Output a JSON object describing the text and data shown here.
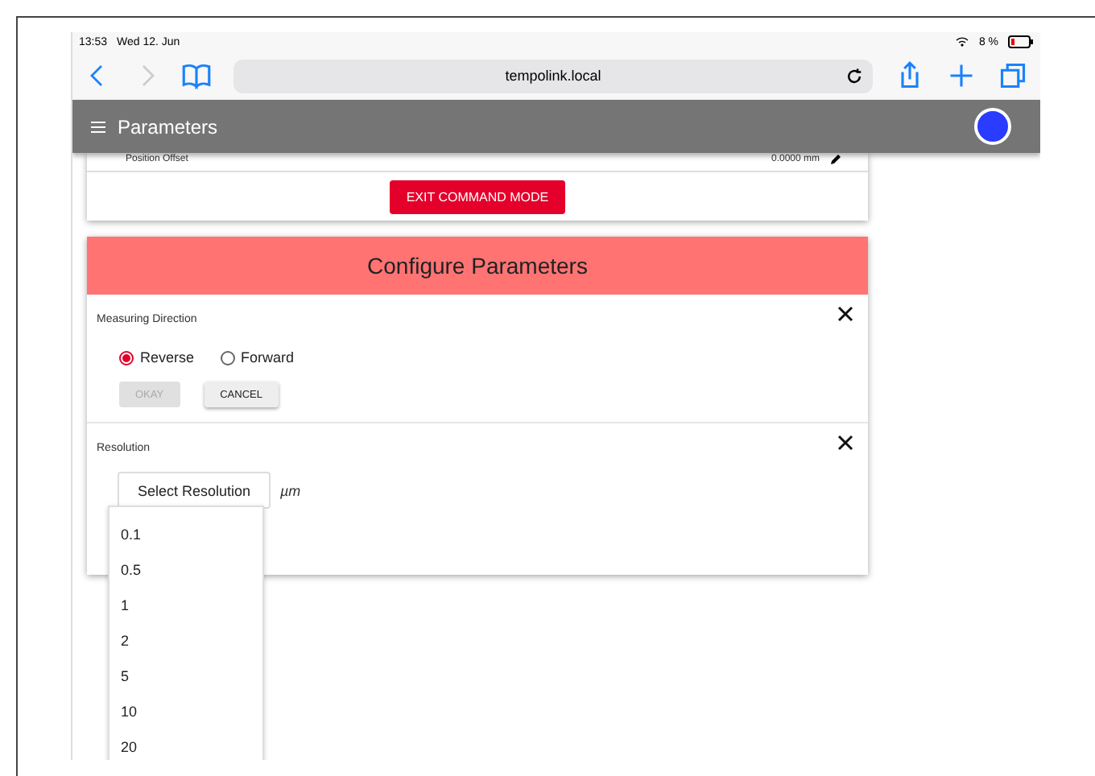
{
  "status_bar": {
    "time": "13:53",
    "date": "Wed 12. Jun",
    "battery": "8 %"
  },
  "browser": {
    "address": "tempolink.local",
    "back_enabled": true,
    "forward_enabled": false
  },
  "app_bar": {
    "title": "Parameters"
  },
  "parameter_row": {
    "label": "Position Offset",
    "value": "0.0000 mm"
  },
  "exit_button": "EXIT COMMAND MODE",
  "dialog": {
    "title": "Configure Parameters",
    "sections": [
      {
        "kind": "radio",
        "label": "Measuring Direction",
        "options": [
          {
            "label": "Reverse",
            "selected": true
          },
          {
            "label": "Forward",
            "selected": false
          }
        ],
        "buttons": [
          {
            "label": "OKAY",
            "disabled": true
          },
          {
            "label": "CANCEL",
            "disabled": false
          }
        ]
      },
      {
        "kind": "select",
        "label": "Resolution",
        "placeholder": "Select Resolution",
        "unit": "µm",
        "options": [
          "0.1",
          "0.5",
          "1",
          "2",
          "5",
          "10",
          "20"
        ]
      }
    ]
  }
}
